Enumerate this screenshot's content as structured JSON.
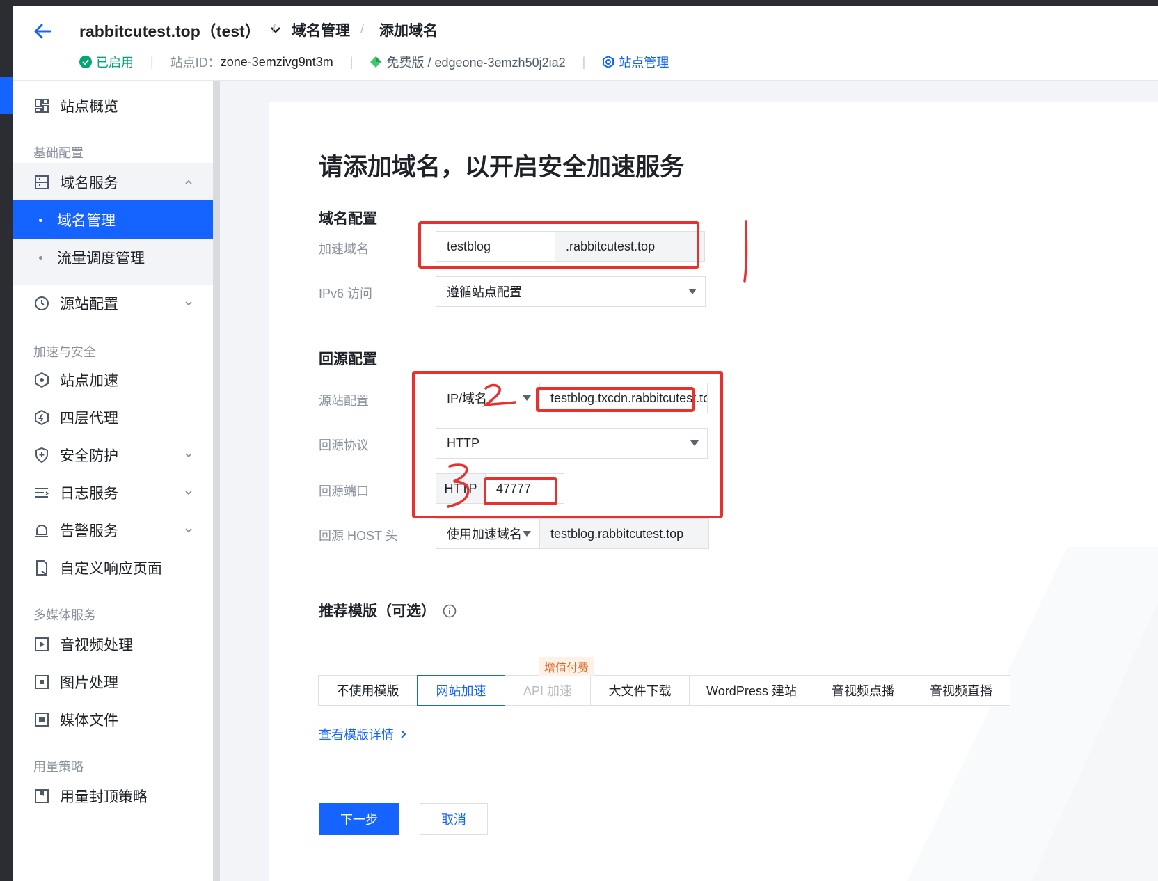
{
  "header": {
    "site_title": "rabbitcutest.top（test）",
    "breadcrumb": [
      "域名管理",
      "添加域名"
    ],
    "status": "已启用",
    "site_id_label": "站点ID：",
    "site_id": "zone-3emzivg9nt3m",
    "plan": "免费版 / edgeone-3emzh50j2ia2",
    "site_manage": "站点管理"
  },
  "sidebar": {
    "overview": "站点概览",
    "section_basic": "基础配置",
    "domain_service": "域名服务",
    "domain_manage": "域名管理",
    "traffic_manage": "流量调度管理",
    "origin_config": "源站配置",
    "section_accel": "加速与安全",
    "site_accel": "站点加速",
    "l4_proxy": "四层代理",
    "security": "安全防护",
    "log_service": "日志服务",
    "alarm_service": "告警服务",
    "custom_page": "自定义响应页面",
    "section_media": "多媒体服务",
    "av_process": "音视频处理",
    "image_process": "图片处理",
    "media_file": "媒体文件",
    "section_usage": "用量策略",
    "usage_cap": "用量封顶策略"
  },
  "form": {
    "page_title": "请添加域名，以开启安全加速服务",
    "domain_section": "域名配置",
    "accel_domain_label": "加速域名",
    "accel_domain_value": "testblog",
    "accel_domain_suffix": ".rabbitcutest.top",
    "ipv6_label": "IPv6 访问",
    "ipv6_value": "遵循站点配置",
    "origin_section": "回源配置",
    "origin_config_label": "源站配置",
    "origin_type": "IP/域名",
    "origin_value": "testblog.txcdn.rabbitcutest.top",
    "origin_protocol_label": "回源协议",
    "origin_protocol_value": "HTTP",
    "origin_port_label": "回源端口",
    "origin_port_prefix": "HTTP",
    "origin_port_value": "47777",
    "host_label": "回源 HOST 头",
    "host_type": "使用加速域名",
    "host_value": "testblog.rabbitcutest.top",
    "template_section": "推荐模版（可选）",
    "paid_badge": "增值付费",
    "templates": [
      "不使用模版",
      "网站加速",
      "API 加速",
      "大文件下载",
      "WordPress 建站",
      "音视频点播",
      "音视频直播"
    ],
    "detail_link": "查看模版详情",
    "next_button": "下一步",
    "cancel_button": "取消"
  }
}
